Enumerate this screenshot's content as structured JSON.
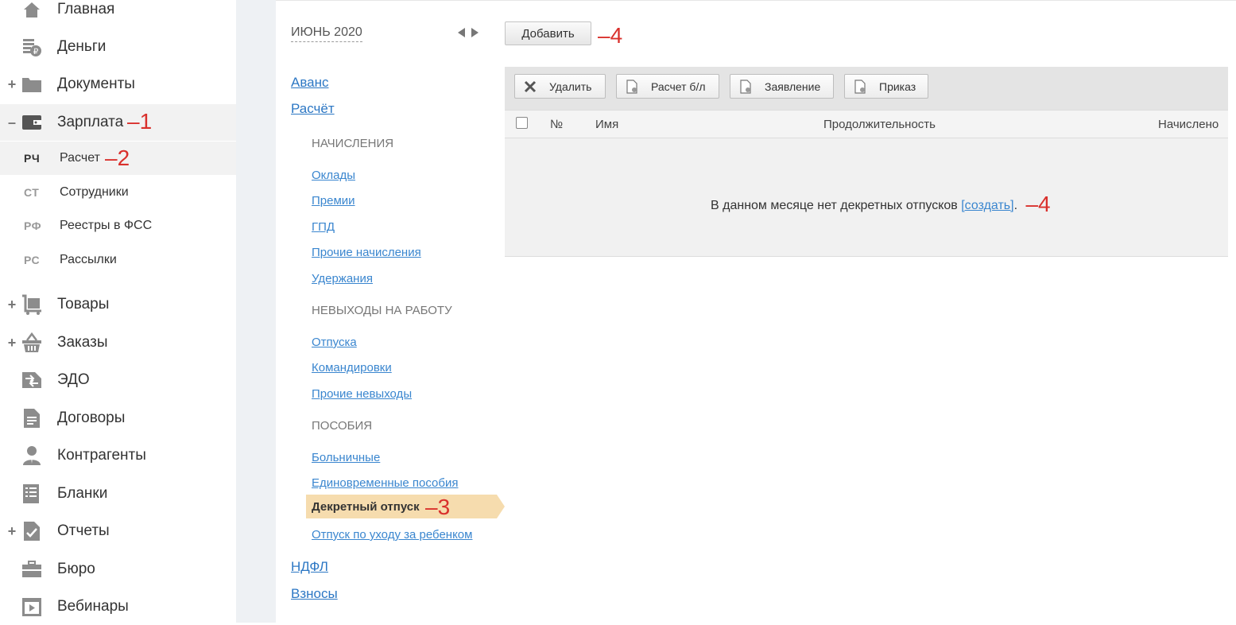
{
  "sidebar": {
    "items": [
      {
        "label": "Главная",
        "icon": "home-icon",
        "plus": ""
      },
      {
        "label": "Деньги",
        "icon": "money-icon",
        "plus": ""
      },
      {
        "label": "Документы",
        "icon": "folder-icon",
        "plus": "+"
      },
      {
        "label": "Зарплата",
        "icon": "wallet-icon",
        "plus": "–",
        "annotation": "–1"
      },
      {
        "label": "Товары",
        "icon": "cart-icon",
        "plus": "+"
      },
      {
        "label": "Заказы",
        "icon": "basket-icon",
        "plus": "+"
      },
      {
        "label": "ЭДО",
        "icon": "exchange-icon",
        "plus": ""
      },
      {
        "label": "Договоры",
        "icon": "contract-icon",
        "plus": ""
      },
      {
        "label": "Контрагенты",
        "icon": "person-icon",
        "plus": ""
      },
      {
        "label": "Бланки",
        "icon": "list-icon",
        "plus": ""
      },
      {
        "label": "Отчеты",
        "icon": "report-icon",
        "plus": "+"
      },
      {
        "label": "Бюро",
        "icon": "briefcase-icon",
        "plus": ""
      },
      {
        "label": "Вебинары",
        "icon": "video-icon",
        "plus": ""
      }
    ],
    "subitems": [
      {
        "code": "РЧ",
        "label": "Расчет",
        "annotation": "–2"
      },
      {
        "code": "СТ",
        "label": "Сотрудники"
      },
      {
        "code": "РФ",
        "label": "Реестры в ФСС"
      },
      {
        "code": "РС",
        "label": "Рассылки"
      }
    ]
  },
  "midnav": {
    "month": "ИЮНЬ 2020",
    "avans": "Аванс",
    "raschet": "Расчёт",
    "sect_accruals": "НАЧИСЛЕНИЯ",
    "accruals": [
      "Оклады",
      "Премии",
      "ГПД",
      "Прочие начисления",
      "Удержания"
    ],
    "sect_absence": "НЕВЫХОДЫ НА РАБОТУ",
    "absence": [
      "Отпуска",
      "Командировки",
      "Прочие невыходы"
    ],
    "sect_benefits": "ПОСОБИЯ",
    "benefits": [
      "Больничные",
      "Единовременные пособия"
    ],
    "selected": "Декретный отпуск",
    "selected_annotation": "–3",
    "after_selected": "Отпуск по уходу за ребенком",
    "ndfl": "НДФЛ",
    "vznosy": "Взносы"
  },
  "main": {
    "add_button": "Добавить",
    "add_annotation": "–4",
    "toolbar": {
      "delete": "Удалить",
      "sick": "Расчет б/л",
      "statement": "Заявление",
      "order": "Приказ"
    },
    "table": {
      "col_num": "№",
      "col_name": "Имя",
      "col_duration": "Продолжительность",
      "col_accrued": "Начислено"
    },
    "empty_text": "В данном месяце нет декретных отпусков ",
    "create_link": "[создать]",
    "empty_tail": ".",
    "empty_annotation": "–4"
  }
}
